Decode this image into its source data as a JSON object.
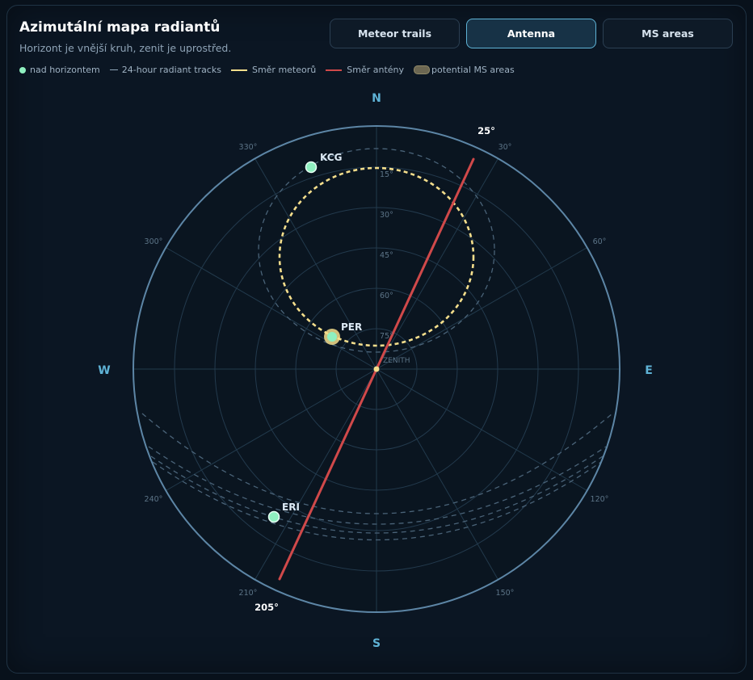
{
  "header": {
    "title": "Azimutální mapa radiantů",
    "subtitle": "Horizont je vnější kruh, zenit je uprostřed."
  },
  "tabs": [
    {
      "label": "Meteor trails",
      "active": false
    },
    {
      "label": "Antenna",
      "active": true
    },
    {
      "label": "MS areas",
      "active": false
    }
  ],
  "legend": {
    "above_horizon": "nad horizontem",
    "radiant_tracks": "24-hour radiant tracks",
    "meteor_direction": "Směr meteorů",
    "antenna_direction": "Směr antény",
    "ms_areas": "potential MS areas"
  },
  "map": {
    "cardinals": {
      "n": "N",
      "e": "E",
      "s": "S",
      "w": "W"
    },
    "zenith_label": "ZENITH",
    "azimuth_labels": [
      "30°",
      "60°",
      "120°",
      "150°",
      "210°",
      "240°",
      "300°",
      "330°"
    ],
    "altitude_labels": [
      "15°",
      "30°",
      "45°",
      "60°",
      "75°"
    ],
    "antenna": {
      "azimuth_label": "25°",
      "back_label": "205°",
      "azimuth": 25
    },
    "radiants": [
      {
        "name": "KCG",
        "az": 330,
        "alt": 10
      },
      {
        "name": "PER",
        "az": 325,
        "alt": 71,
        "highlight": true
      },
      {
        "name": "ERI",
        "az": 225,
        "alt": 0
      }
    ]
  },
  "colors": {
    "accent": "#5fb3d6",
    "horizon": "#5d86a6",
    "grid": "#2d4457",
    "antenna": "#d0494a",
    "meteor": "#f4de8c",
    "radiant": "#8ff0c0"
  }
}
